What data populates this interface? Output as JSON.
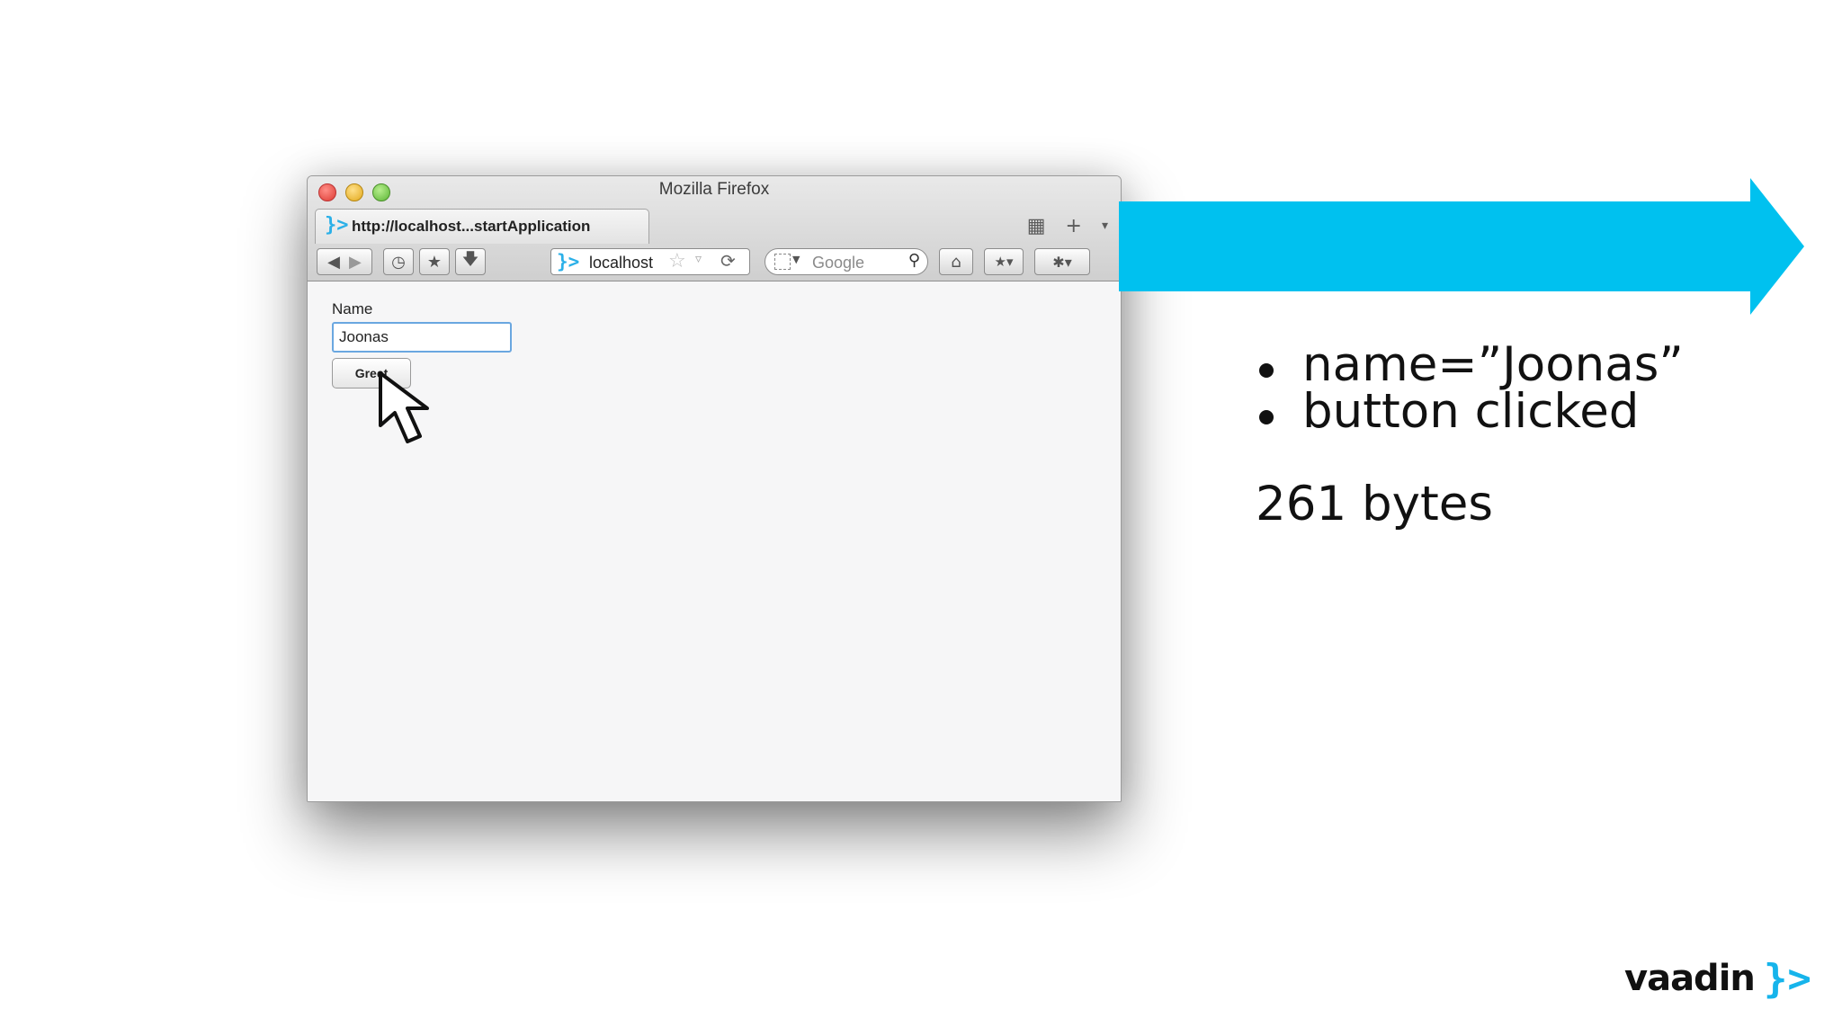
{
  "browser": {
    "window_title": "Mozilla Firefox",
    "tab": {
      "label": "http://localhost...startApplication",
      "favicon": "vaadin-logo-icon"
    },
    "url": "localhost",
    "search_placeholder": "Google"
  },
  "form": {
    "name_label": "Name",
    "name_value": "Joonas",
    "greet_label": "Greet"
  },
  "slide": {
    "bullets": [
      "name=”Joonas”",
      "button clicked"
    ],
    "bytes": "261 bytes",
    "arrow_color": "#00c1ef",
    "logo_word": "vaadin",
    "logo_mark": "}>",
    "brand_color": "#16b4eb"
  }
}
